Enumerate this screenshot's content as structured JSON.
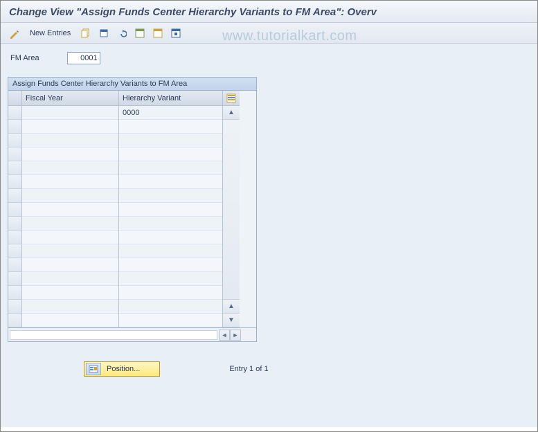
{
  "title": "Change View \"Assign Funds Center Hierarchy Variants to FM Area\": Overv",
  "watermark": "www.tutorialkart.com",
  "toolbar": {
    "new_entries_label": "New Entries"
  },
  "form": {
    "fm_area_label": "FM Area",
    "fm_area_value": "0001"
  },
  "table": {
    "panel_title": "Assign Funds Center Hierarchy Variants to FM Area",
    "columns": {
      "fiscal_year": "Fiscal Year",
      "hierarchy_variant": "Hierarchy Variant"
    },
    "rows": [
      {
        "fiscal_year": "",
        "hierarchy_variant": "0000"
      },
      {
        "fiscal_year": "",
        "hierarchy_variant": ""
      },
      {
        "fiscal_year": "",
        "hierarchy_variant": ""
      },
      {
        "fiscal_year": "",
        "hierarchy_variant": ""
      },
      {
        "fiscal_year": "",
        "hierarchy_variant": ""
      },
      {
        "fiscal_year": "",
        "hierarchy_variant": ""
      },
      {
        "fiscal_year": "",
        "hierarchy_variant": ""
      },
      {
        "fiscal_year": "",
        "hierarchy_variant": ""
      },
      {
        "fiscal_year": "",
        "hierarchy_variant": ""
      },
      {
        "fiscal_year": "",
        "hierarchy_variant": ""
      },
      {
        "fiscal_year": "",
        "hierarchy_variant": ""
      },
      {
        "fiscal_year": "",
        "hierarchy_variant": ""
      },
      {
        "fiscal_year": "",
        "hierarchy_variant": ""
      },
      {
        "fiscal_year": "",
        "hierarchy_variant": ""
      },
      {
        "fiscal_year": "",
        "hierarchy_variant": ""
      },
      {
        "fiscal_year": "",
        "hierarchy_variant": ""
      }
    ]
  },
  "footer": {
    "position_label": "Position...",
    "entry_text": "Entry 1 of 1"
  }
}
